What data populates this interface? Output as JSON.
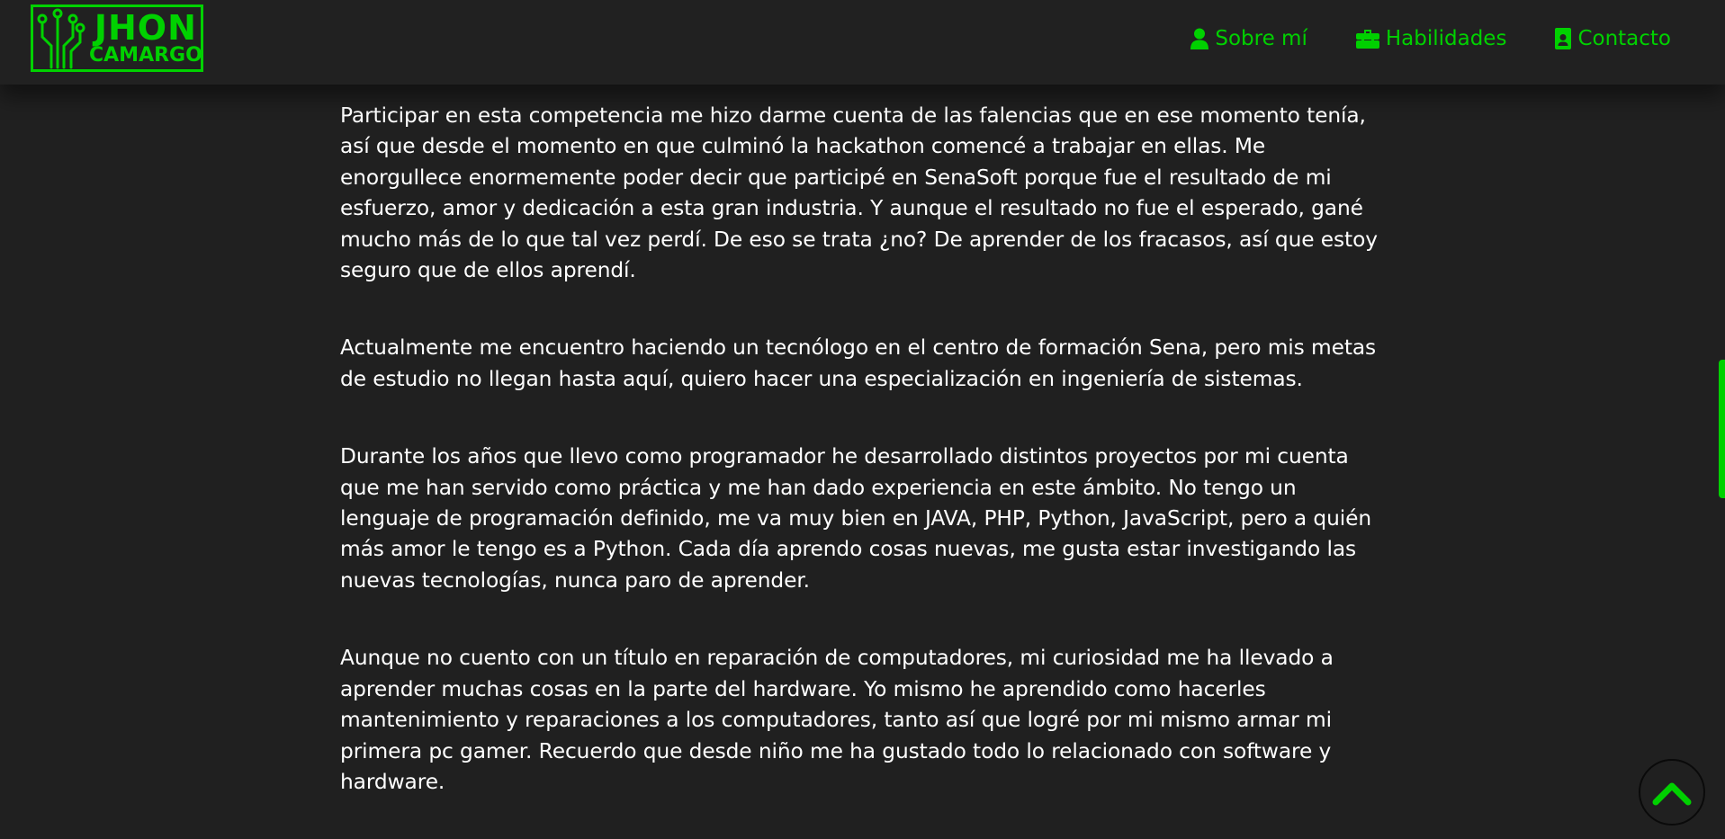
{
  "brand": {
    "line1": "JHON",
    "line2": "CAMARGO"
  },
  "nav": {
    "items": [
      {
        "label": "Sobre mí",
        "icon": "user-icon"
      },
      {
        "label": "Habilidades",
        "icon": "toolbox-icon"
      },
      {
        "label": "Contacto",
        "icon": "contact-card-icon"
      }
    ]
  },
  "content": {
    "paragraphs": [
      "Participar en esta competencia me hizo darme cuenta de las falencias que en ese momento tenía, así que desde el momento en que culminó la hackathon comencé a trabajar en ellas. Me enorgullece enormemente poder decir que participé en SenaSoft porque fue el resultado de mi esfuerzo, amor y dedicación a esta gran industria. Y aunque el resultado no fue el esperado, gané mucho más de lo que tal vez perdí. De eso se trata ¿no? De aprender de los fracasos, así que estoy seguro que de ellos aprendí.",
      "Actualmente me encuentro haciendo un tecnólogo en el centro de formación Sena, pero mis metas de estudio no llegan hasta aquí, quiero hacer una especialización en ingeniería de sistemas.",
      "Durante los años que llevo como programador he desarrollado distintos proyectos por mi cuenta que me han servido como práctica y me han dado experiencia en este ámbito. No tengo un lenguaje de programación definido, me va muy bien en JAVA, PHP, Python, JavaScript, pero a quién más amor le tengo es a Python. Cada día aprendo cosas nuevas, me gusta estar investigando las nuevas tecnologías, nunca paro de aprender.",
      "Aunque no cuento con un título en reparación de computadores, mi curiosidad me ha llevado a aprender muchas cosas en la parte del hardware. Yo mismo he aprendido como hacerles mantenimiento y reparaciones a los computadores, tanto así que logré por mi mismo armar mi primera pc gamer. Recuerdo que desde niño me ha gustado todo lo relacionado con software y hardware."
    ]
  },
  "scroll_to_top": {
    "icon": "chevron-up-icon"
  },
  "colors": {
    "accent": "#00d100",
    "background": "#202020",
    "header": "#212121",
    "text": "#ffffff"
  }
}
